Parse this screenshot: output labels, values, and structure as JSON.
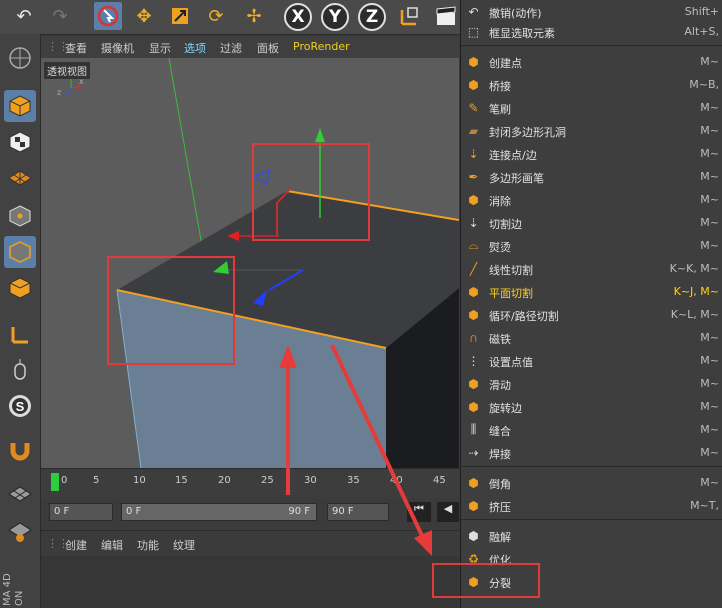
{
  "toolbar": {
    "undo_icon": "undo-icon",
    "redo_icon": "redo-icon",
    "axes": [
      "X",
      "Y",
      "Z"
    ]
  },
  "viewport_menu": {
    "items": [
      "查看",
      "摄像机",
      "显示",
      "选项",
      "过滤",
      "面板",
      "ProRender"
    ]
  },
  "viewport": {
    "label": "透视视图"
  },
  "timeline": {
    "ticks": [
      "0",
      "5",
      "10",
      "15",
      "20",
      "25",
      "30",
      "35",
      "40",
      "45"
    ]
  },
  "frames": {
    "start": "0 F",
    "range_start": "0 F",
    "range_end": "90 F",
    "end": "90 F"
  },
  "bottom_menu": {
    "items": [
      "创建",
      "编辑",
      "功能",
      "纹理"
    ]
  },
  "brand": {
    "text": "MA 4D",
    "sub": "ON"
  },
  "menu": {
    "items": [
      {
        "label": "撤销(动作)",
        "shortcut": "Shift+",
        "icon": "undo-action-icon"
      },
      {
        "label": "框显选取元素",
        "shortcut": "Alt+S,",
        "icon": "frame-selected-icon"
      },
      {
        "label": "创建点",
        "shortcut": "M~",
        "icon": "create-point-icon"
      },
      {
        "label": "桥接",
        "shortcut": "M~B,",
        "icon": "bridge-icon"
      },
      {
        "label": "笔刷",
        "shortcut": "M~",
        "icon": "brush-icon"
      },
      {
        "label": "封闭多边形孔洞",
        "shortcut": "M~",
        "icon": "close-hole-icon"
      },
      {
        "label": "连接点/边",
        "shortcut": "M~",
        "icon": "connect-icon"
      },
      {
        "label": "多边形画笔",
        "shortcut": "M~",
        "icon": "polygon-pen-icon"
      },
      {
        "label": "消除",
        "shortcut": "M~",
        "icon": "dissolve-icon"
      },
      {
        "label": "切割边",
        "shortcut": "M~",
        "icon": "cut-edges-icon"
      },
      {
        "label": "熨烫",
        "shortcut": "M~",
        "icon": "iron-icon"
      },
      {
        "label": "线性切割",
        "shortcut": "K~K, M~",
        "icon": "line-cut-icon"
      },
      {
        "label": "平面切割",
        "shortcut": "K~J, M~",
        "icon": "plane-cut-icon"
      },
      {
        "label": "循环/路径切割",
        "shortcut": "K~L, M~",
        "icon": "loop-cut-icon"
      },
      {
        "label": "磁铁",
        "shortcut": "M~",
        "icon": "magnet-icon"
      },
      {
        "label": "设置点值",
        "shortcut": "M~",
        "icon": "set-point-icon"
      },
      {
        "label": "滑动",
        "shortcut": "M~",
        "icon": "slide-icon"
      },
      {
        "label": "旋转边",
        "shortcut": "M~",
        "icon": "spin-edge-icon"
      },
      {
        "label": "缝合",
        "shortcut": "M~",
        "icon": "stitch-icon"
      },
      {
        "label": "焊接",
        "shortcut": "M~",
        "icon": "weld-icon"
      },
      {
        "label": "倒角",
        "shortcut": "M~",
        "icon": "bevel-icon"
      },
      {
        "label": "挤压",
        "shortcut": "M~T,",
        "icon": "extrude-icon"
      },
      {
        "label": "融解",
        "shortcut": "",
        "icon": "melt-icon"
      },
      {
        "label": "优化",
        "shortcut": "",
        "icon": "optimize-icon"
      },
      {
        "label": "分裂",
        "shortcut": "",
        "icon": "split-icon"
      }
    ]
  }
}
